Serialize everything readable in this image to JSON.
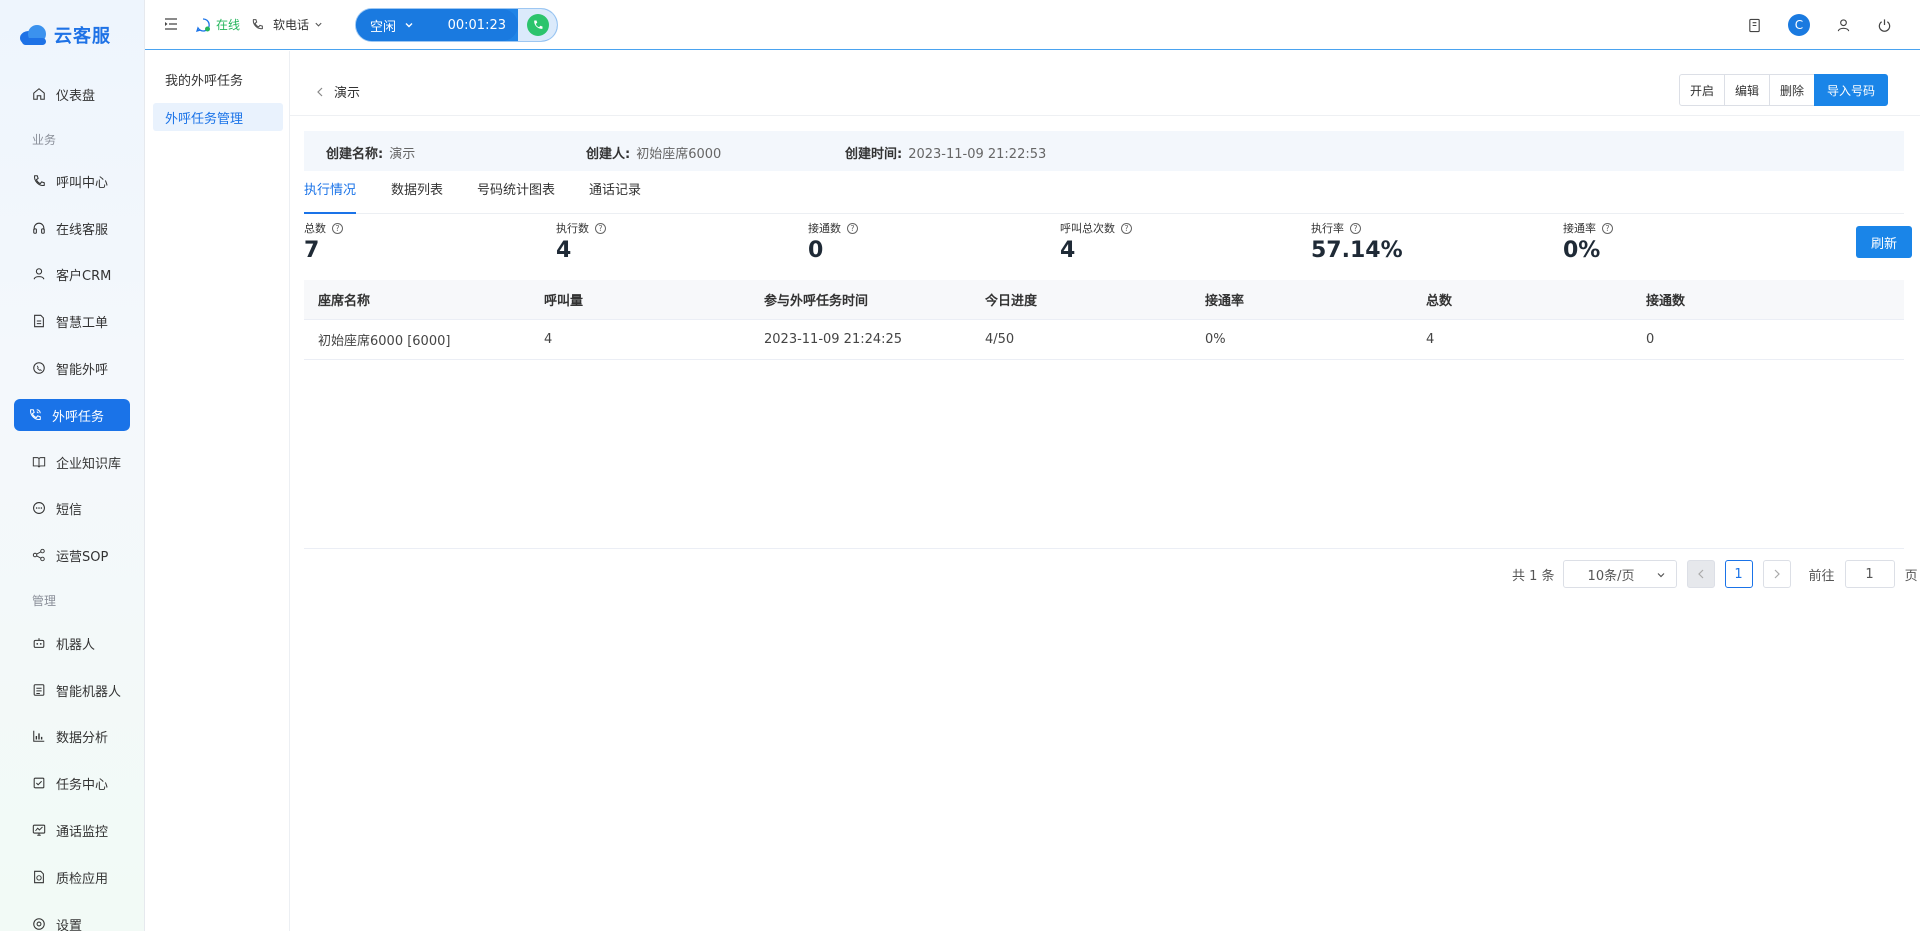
{
  "app": {
    "brand": "云客服"
  },
  "sidebar": {
    "items": [
      {
        "label": "仪表盘",
        "icon": "home-icon"
      },
      {
        "label": "呼叫中心",
        "icon": "phone-icon"
      },
      {
        "label": "在线客服",
        "icon": "headset-icon"
      },
      {
        "label": "客户CRM",
        "icon": "user-icon"
      },
      {
        "label": "智慧工单",
        "icon": "document-icon"
      },
      {
        "label": "智能外呼",
        "icon": "whatsapp-phone-icon"
      },
      {
        "label": "外呼任务",
        "icon": "phone-call-icon",
        "active": true
      },
      {
        "label": "企业知识库",
        "icon": "book-icon"
      },
      {
        "label": "短信",
        "icon": "chat-dots-icon"
      },
      {
        "label": "运营SOP",
        "icon": "share-nodes-icon"
      },
      {
        "label": "机器人",
        "icon": "robot-icon"
      },
      {
        "label": "智能机器人",
        "icon": "smart-robot-icon"
      },
      {
        "label": "数据分析",
        "icon": "bar-chart-icon"
      },
      {
        "label": "任务中心",
        "icon": "task-check-icon"
      },
      {
        "label": "通话监控",
        "icon": "monitor-icon"
      },
      {
        "label": "质检应用",
        "icon": "quality-check-icon"
      },
      {
        "label": "设置",
        "icon": "gear-icon"
      }
    ],
    "groups": {
      "business": "业务",
      "management": "管理"
    }
  },
  "header": {
    "online_status": "在线",
    "phone_mode": "软电话",
    "call_state": "空闲",
    "call_timer": "00:01:23",
    "avatar_letter": "C"
  },
  "subnav": {
    "items": [
      {
        "label": "我的外呼任务"
      },
      {
        "label": "外呼任务管理",
        "active": true
      }
    ]
  },
  "task": {
    "title": "演示",
    "buttons": {
      "start": "开启",
      "edit": "编辑",
      "delete": "删除",
      "import": "导入号码"
    },
    "info": {
      "name_label": "创建名称:",
      "name_value": "演示",
      "creator_label": "创建人:",
      "creator_value": "初始座席6000",
      "time_label": "创建时间:",
      "time_value": "2023-11-09 21:22:53"
    },
    "tabs": [
      "执行情况",
      "数据列表",
      "号码统计图表",
      "通话记录"
    ],
    "stats": [
      {
        "label": "总数",
        "value": "7"
      },
      {
        "label": "执行数",
        "value": "4"
      },
      {
        "label": "接通数",
        "value": "0"
      },
      {
        "label": "呼叫总次数",
        "value": "4"
      },
      {
        "label": "执行率",
        "value": "57.14%"
      },
      {
        "label": "接通率",
        "value": "0%"
      }
    ],
    "refresh_label": "刷新",
    "table": {
      "columns": [
        "座席名称",
        "呼叫量",
        "参与外呼任务时间",
        "今日进度",
        "接通率",
        "总数",
        "接通数"
      ],
      "rows": [
        [
          "初始座席6000 [6000]",
          "4",
          "2023-11-09 21:24:25",
          "4/50",
          "0%",
          "4",
          "0"
        ]
      ]
    },
    "pagination": {
      "total_text": "共 1 条",
      "page_size": "10条/页",
      "current_page": "1",
      "goto_label": "前往",
      "goto_value": "1",
      "page_unit": "页"
    }
  },
  "colors": {
    "accent": "#1a73e8",
    "online": "#25b65c",
    "call_bar": "#1a7ae0"
  }
}
